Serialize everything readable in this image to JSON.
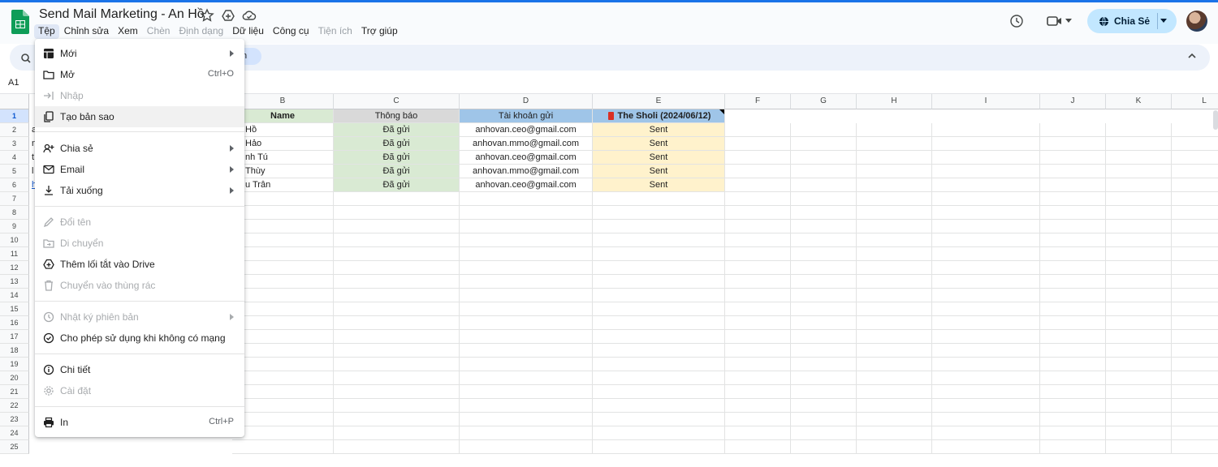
{
  "app": {
    "doc_title": "Send Mail Marketing - An Hồ",
    "share_label": "Chia Sẻ",
    "name_box": "A1",
    "partial_pill": "n"
  },
  "menubar": [
    {
      "label": "Tệp",
      "active": true
    },
    {
      "label": "Chỉnh sửa"
    },
    {
      "label": "Xem"
    },
    {
      "label": "Chèn",
      "dim": true
    },
    {
      "label": "Định dạng",
      "dim": true
    },
    {
      "label": "Dữ liệu"
    },
    {
      "label": "Công cụ"
    },
    {
      "label": "Tiện ích",
      "dim": true
    },
    {
      "label": "Trợ giúp"
    }
  ],
  "file_menu": {
    "new": "Mới",
    "open": "Mở",
    "open_shortcut": "Ctrl+O",
    "import": "Nhập",
    "make_copy": "Tạo bản sao",
    "share": "Chia sẻ",
    "email": "Email",
    "download": "Tải xuống",
    "rename": "Đổi tên",
    "move": "Di chuyển",
    "add_shortcut": "Thêm lối tắt vào Drive",
    "trash": "Chuyển vào thùng rác",
    "version_history": "Nhật ký phiên bản",
    "offline": "Cho phép sử dụng khi không có mạng",
    "details": "Chi tiết",
    "settings": "Cài đặt",
    "print": "In",
    "print_shortcut": "Ctrl+P"
  },
  "sheet": {
    "columns": [
      "B",
      "C",
      "D",
      "E",
      "F",
      "G",
      "H",
      "I",
      "J",
      "K",
      "L"
    ],
    "rows": [
      "1",
      "2",
      "3",
      "4",
      "5",
      "6",
      "7",
      "8",
      "9",
      "10",
      "11",
      "12",
      "13",
      "14",
      "15",
      "16",
      "17",
      "18",
      "19",
      "20",
      "21",
      "22",
      "23",
      "24",
      "25"
    ],
    "header_row": {
      "name": "Name",
      "status": "Thông báo",
      "account": "Tài khoản gửi",
      "campaign": "The Sholi (2024/06/12)"
    },
    "left_fragments": [
      "a",
      "n",
      "t",
      "l",
      "h"
    ],
    "data_rows": [
      {
        "name": "Hồ",
        "status": "Đã gửi",
        "account": "anhovan.ceo@gmail.com",
        "campaign": "Sent"
      },
      {
        "name": "Hảo",
        "status": "Đã gửi",
        "account": "anhovan.mmo@gmail.com",
        "campaign": "Sent"
      },
      {
        "name": "nh Tú",
        "status": "Đã gửi",
        "account": "anhovan.ceo@gmail.com",
        "campaign": "Sent"
      },
      {
        "name": "Thùy",
        "status": "Đã gửi",
        "account": "anhovan.mmo@gmail.com",
        "campaign": "Sent"
      },
      {
        "name": "u Trân",
        "status": "Đã gửi",
        "account": "anhovan.ceo@gmail.com",
        "campaign": "Sent"
      }
    ]
  },
  "colors": {
    "accent": "#1a73e8",
    "name_header_bg": "#d9ead3",
    "status_header_bg": "#d9d9d9",
    "account_header_bg": "#9fc5e8",
    "campaign_header_bg": "#9fc5e8",
    "status_cell_bg": "#d9ead3",
    "campaign_cell_bg": "#fff2cc"
  }
}
